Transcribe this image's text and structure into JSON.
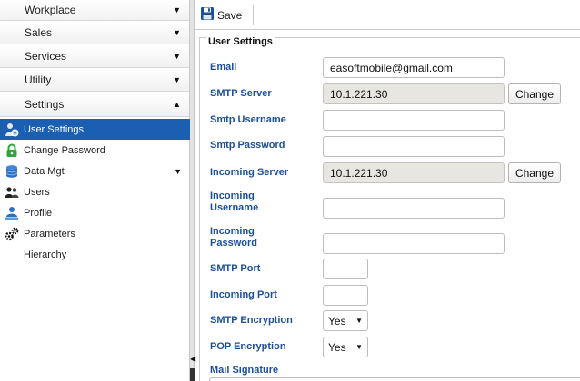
{
  "sidebar": {
    "sections": [
      {
        "label": "Workplace",
        "arrow": "▼"
      },
      {
        "label": "Sales",
        "arrow": "▼"
      },
      {
        "label": "Services",
        "arrow": "▼"
      },
      {
        "label": "Utility",
        "arrow": "▼"
      },
      {
        "label": "Settings",
        "arrow": "▲"
      }
    ],
    "items": [
      {
        "label": "User Settings",
        "icon": "user-settings-icon",
        "active": true
      },
      {
        "label": "Change Password",
        "icon": "lock-icon"
      },
      {
        "label": "Data Mgt",
        "icon": "database-icon",
        "arrow": "▼"
      },
      {
        "label": "Users",
        "icon": "users-icon"
      },
      {
        "label": "Profile",
        "icon": "profile-icon"
      },
      {
        "label": "Parameters",
        "icon": "gears-icon"
      },
      {
        "label": "Hierarchy",
        "icon": ""
      }
    ]
  },
  "toolbar": {
    "save_label": "Save",
    "save_icon": "floppy-disk-icon"
  },
  "form": {
    "legend": "User Settings",
    "email": {
      "label": "Email",
      "value": "easoftmobile@gmail.com"
    },
    "smtp_server": {
      "label": "SMTP Server",
      "value": "10.1.221.30",
      "button": "Change"
    },
    "smtp_username": {
      "label": "Smtp Username",
      "value": ""
    },
    "smtp_password": {
      "label": "Smtp Password",
      "value": ""
    },
    "incoming_server": {
      "label": "Incoming Server",
      "value": "10.1.221.30",
      "button": "Change"
    },
    "incoming_username": {
      "label_line1": "Incoming",
      "label_line2": "Username",
      "value": ""
    },
    "incoming_password": {
      "label_line1": "Incoming",
      "label_line2": "Password",
      "value": ""
    },
    "smtp_port": {
      "label": "SMTP Port",
      "value": ""
    },
    "incoming_port": {
      "label": "Incoming Port",
      "value": ""
    },
    "smtp_encryption": {
      "label": "SMTP Encryption",
      "value": "Yes"
    },
    "pop_encryption": {
      "label": "POP Encryption",
      "value": "Yes"
    },
    "mail_signature": {
      "label": "Mail Signature"
    }
  },
  "colors": {
    "accent": "#1b5fb2",
    "label": "#1b4f9a",
    "readonly_bg": "#e8e6e1"
  }
}
